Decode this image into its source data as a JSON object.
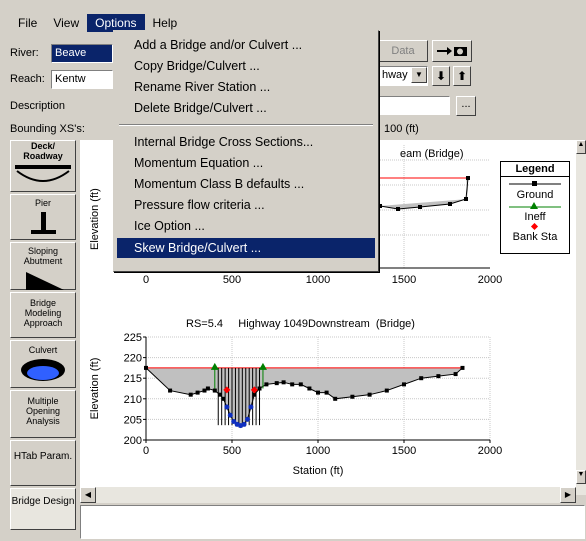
{
  "menubar": {
    "items": [
      {
        "label": "File",
        "underline": "F"
      },
      {
        "label": "View",
        "underline": "V"
      },
      {
        "label": "Options",
        "underline": "O"
      },
      {
        "label": "Help",
        "underline": "H"
      }
    ]
  },
  "form": {
    "river_label": "River:",
    "river_value": "Beave",
    "reach_label": "Reach:",
    "reach_value": "Kentw",
    "description_label": "Description",
    "bounding_label": "Bounding XS's:",
    "data_button": "Data",
    "reach_dropdown_value": "hway",
    "bounding_value": "100 (ft)"
  },
  "toolbar": {
    "items": [
      {
        "label": "Deck/ Roadway"
      },
      {
        "label": "Pier"
      },
      {
        "label": "Sloping Abutment"
      },
      {
        "label": "Bridge Modeling Approach"
      },
      {
        "label": "Culvert"
      },
      {
        "label": "Multiple Opening Analysis"
      },
      {
        "label": "HTab Param."
      },
      {
        "label": "Bridge Design"
      }
    ]
  },
  "options_menu": {
    "items": [
      {
        "label": "Add a Bridge and/or Culvert ...",
        "u": "A"
      },
      {
        "label": "Copy Bridge/Culvert ...",
        "u": "C"
      },
      {
        "label": "Rename River Station ...",
        "u": "R"
      },
      {
        "label": "Delete Bridge/Culvert ...",
        "u": "D"
      },
      {
        "label": "Internal Bridge Cross Sections...",
        "u": "I"
      },
      {
        "label": "Momentum Equation ...",
        "u": "M"
      },
      {
        "label": "Momentum Class B defaults ...",
        "u": ""
      },
      {
        "label": "Pressure flow criteria ...",
        "u": "P"
      },
      {
        "label": "Ice Option ...",
        "u": ""
      },
      {
        "label": "Skew Bridge/Culvert ...",
        "u": "S"
      }
    ],
    "highlighted_index": 9
  },
  "legend": {
    "title": "Legend",
    "entries": [
      {
        "name": "Ground",
        "color": "#000000"
      },
      {
        "name": "Ineff",
        "color": "#008000"
      },
      {
        "name": "Bank Sta",
        "color": "#ff0000"
      }
    ]
  },
  "top_plot": {
    "title_fragment": "eam (Bridge)",
    "ylabel": "Elevation (ft)",
    "xticks": [
      "0",
      "500",
      "1000",
      "1500",
      "2000"
    ]
  },
  "chart_data": {
    "type": "line",
    "title": "RS=5.4     Highway 1049Downstream  (Bridge)",
    "xlabel": "Station (ft)",
    "ylabel": "Elevation (ft)",
    "xlim": [
      0,
      2000
    ],
    "ylim": [
      200,
      225
    ],
    "xticks": [
      0,
      500,
      1000,
      1500,
      2000
    ],
    "yticks": [
      200,
      205,
      210,
      215,
      220,
      225
    ],
    "series": [
      {
        "name": "Ground",
        "color": "#000000",
        "x": [
          0,
          140,
          260,
          300,
          340,
          360,
          400,
          430,
          450,
          470,
          490,
          510,
          530,
          550,
          570,
          590,
          610,
          630,
          660,
          700,
          760,
          800,
          850,
          900,
          950,
          1000,
          1050,
          1100,
          1200,
          1300,
          1400,
          1500,
          1600,
          1700,
          1800,
          1840
        ],
        "y": [
          217.5,
          212,
          211,
          211.5,
          212,
          212.5,
          212,
          211,
          210,
          208,
          206,
          204.5,
          203.8,
          203.5,
          203.8,
          205,
          208,
          211,
          212.5,
          213.5,
          213.8,
          214,
          213.5,
          213.5,
          212.5,
          211.5,
          211.5,
          210,
          210.5,
          211,
          212,
          213.5,
          215,
          215.5,
          216,
          217.5
        ]
      }
    ],
    "markers": {
      "ineff": [
        {
          "x": 400,
          "y": 217.5
        },
        {
          "x": 680,
          "y": 217.5
        }
      ],
      "bank_sta": [
        {
          "x": 470,
          "y": 212
        },
        {
          "x": 630,
          "y": 212
        }
      ]
    },
    "ws_elevation": 217.5
  },
  "colors": {
    "selection": "#0a246a",
    "face": "#d4d0c8",
    "desktop": "#16407a"
  }
}
